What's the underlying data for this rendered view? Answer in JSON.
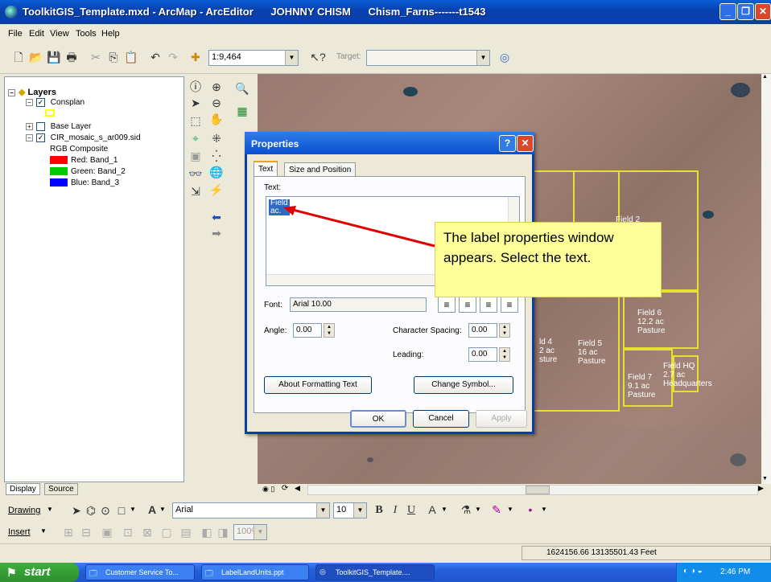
{
  "title_bar": {
    "text": "ToolkitGIS_Template.mxd - ArcMap - ArcEditor      JOHNNY CHISM      Chism_Farns-------t1543"
  },
  "menu": [
    "File",
    "Edit",
    "View",
    "Tools",
    "Help"
  ],
  "toolbar": {
    "scale_value": "1:9,464",
    "target_label": "Target:"
  },
  "toc": {
    "root_label": "Layers",
    "consplan_label": "Consplan",
    "base_layer_label": "Base Layer",
    "raster_label": "CIR_mosaic_s_ar009.sid",
    "rgb_label": "RGB Composite",
    "red_label": "Red:   Band_1",
    "green_label": "Green: Band_2",
    "blue_label": "Blue:  Band_3",
    "tab_display": "Display",
    "tab_source": "Source"
  },
  "colors": {
    "red_band": "#ff0000",
    "green_band": "#00cc00",
    "blue_band": "#0000ff",
    "field_outline": "#e8e030",
    "consplan_symbol": "#ffff00"
  },
  "map": {
    "field2_label": "Field 2",
    "field4_lines": [
      "ld 4",
      "2 ac",
      "sture"
    ],
    "field5_lines": [
      "Field 5",
      "16 ac",
      "Pasture"
    ],
    "field6_lines": [
      "Field 6",
      "12.2 ac",
      "Pasture"
    ],
    "field7_lines": [
      "Field 7",
      "9.1 ac",
      "Pasture"
    ],
    "fieldhq_lines": [
      "Field HQ",
      "2.7 ac",
      "Headquarters"
    ]
  },
  "dialog": {
    "title": "Properties",
    "help_glyph": "?",
    "tab_text": "Text",
    "tab_size": "Size and Position",
    "text_label": "Text:",
    "text_line1": "Field",
    "text_line2": "ac.",
    "font_label": "Font:",
    "font_value": "Arial 10.00",
    "angle_label": "Angle:",
    "angle_value": "0.00",
    "char_spacing_label": "Character Spacing:",
    "char_spacing_value": "0.00",
    "leading_label": "Leading:",
    "leading_value": "0.00",
    "about_button": "About Formatting Text",
    "change_symbol_button": "Change Symbol...",
    "ok_button": "OK",
    "cancel_button": "Cancel",
    "apply_button": "Apply"
  },
  "callout": {
    "text": "The label properties window appears. Select the text."
  },
  "drawing_bar": {
    "drawing_label": "Drawing",
    "font_name": "Arial",
    "font_size": "10",
    "bold": "B",
    "italic": "I",
    "underline": "U"
  },
  "insert_bar": {
    "insert_label": "Insert",
    "zoom_value": "100%"
  },
  "status": {
    "coords": "1624156.66  13135501.43 Feet"
  },
  "taskbar": {
    "start_label": "start",
    "task1": "Customer Service To...",
    "task2": "LabelLandUnits.ppt",
    "task3": "ToolkitGIS_Template....",
    "clock": "2:46 PM"
  }
}
